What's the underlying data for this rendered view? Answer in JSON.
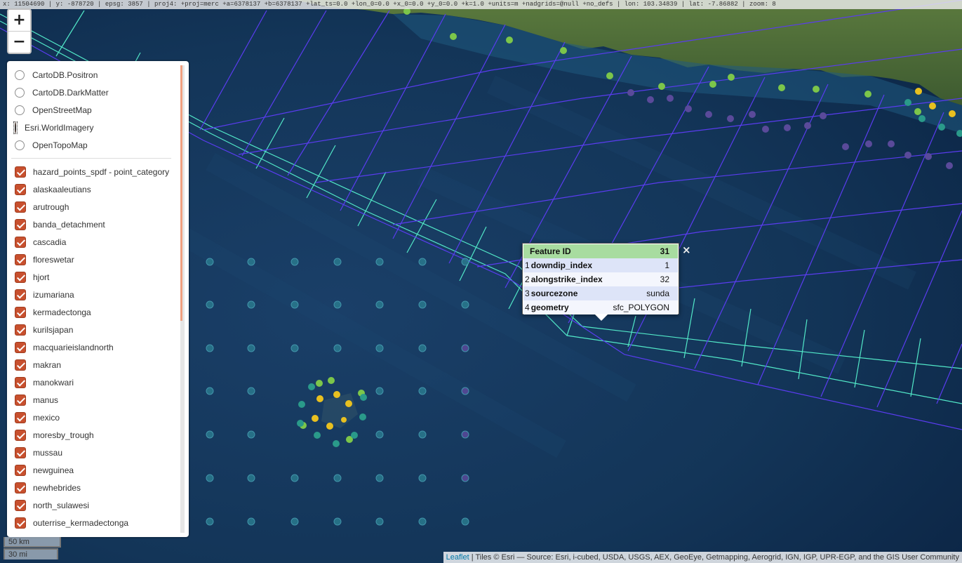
{
  "coord_bar": "x: 11504690 | y: -878720 | epsg: 3857 | proj4: +proj=merc +a=6378137 +b=6378137 +lat_ts=0.0 +lon_0=0.0 +x_0=0.0 +y_0=0.0 +k=1.0 +units=m +nadgrids=@null +no_defs | lon: 103.34839 | lat: -7.86882 | zoom: 8",
  "zoom": {
    "in": "+",
    "out": "−"
  },
  "base_layers": [
    {
      "label": "CartoDB.Positron",
      "checked": false
    },
    {
      "label": "CartoDB.DarkMatter",
      "checked": false
    },
    {
      "label": "OpenStreetMap",
      "checked": false
    },
    {
      "label": "Esri.WorldImagery",
      "checked": true
    },
    {
      "label": "OpenTopoMap",
      "checked": false
    }
  ],
  "overlay_layers": [
    "hazard_points_spdf - point_category",
    "alaskaaleutians",
    "arutrough",
    "banda_detachment",
    "cascadia",
    "floreswetar",
    "hjort",
    "izumariana",
    "kermadectonga",
    "kurilsjapan",
    "macquarieislandnorth",
    "makran",
    "manokwari",
    "manus",
    "mexico",
    "moresby_trough",
    "mussau",
    "newguinea",
    "newhebrides",
    "north_sulawesi",
    "outerrise_kermadectonga"
  ],
  "popup": {
    "header": {
      "label": "Feature ID",
      "value": "31"
    },
    "rows": [
      {
        "idx": "1",
        "key": "downdip_index",
        "value": "1"
      },
      {
        "idx": "2",
        "key": "alongstrike_index",
        "value": "32"
      },
      {
        "idx": "3",
        "key": "sourcezone",
        "value": "sunda"
      },
      {
        "idx": "4",
        "key": "geometry",
        "value": "sfc_POLYGON"
      }
    ],
    "close": "×"
  },
  "scale": {
    "km": "50 km",
    "mi": "30 mi"
  },
  "attribution": {
    "link": "Leaflet",
    "text": " | Tiles © Esri — Source: Esri, i-cubed, USDA, USGS, AEX, GeoEye, Getmapping, Aerogrid, IGN, IGP, UPR-EGP, and the GIS User Community"
  },
  "colors": {
    "ocean": "#0f2a4d",
    "land": "#4f6a3a",
    "grid_blue": "#5a3cf0",
    "grid_cyan": "#52e8c8",
    "accent": "#c8502e",
    "point_teal": "#2a7a8e",
    "point_green": "#7cc64a",
    "point_yellow": "#e8c020",
    "point_purple": "#5a4a9a"
  }
}
